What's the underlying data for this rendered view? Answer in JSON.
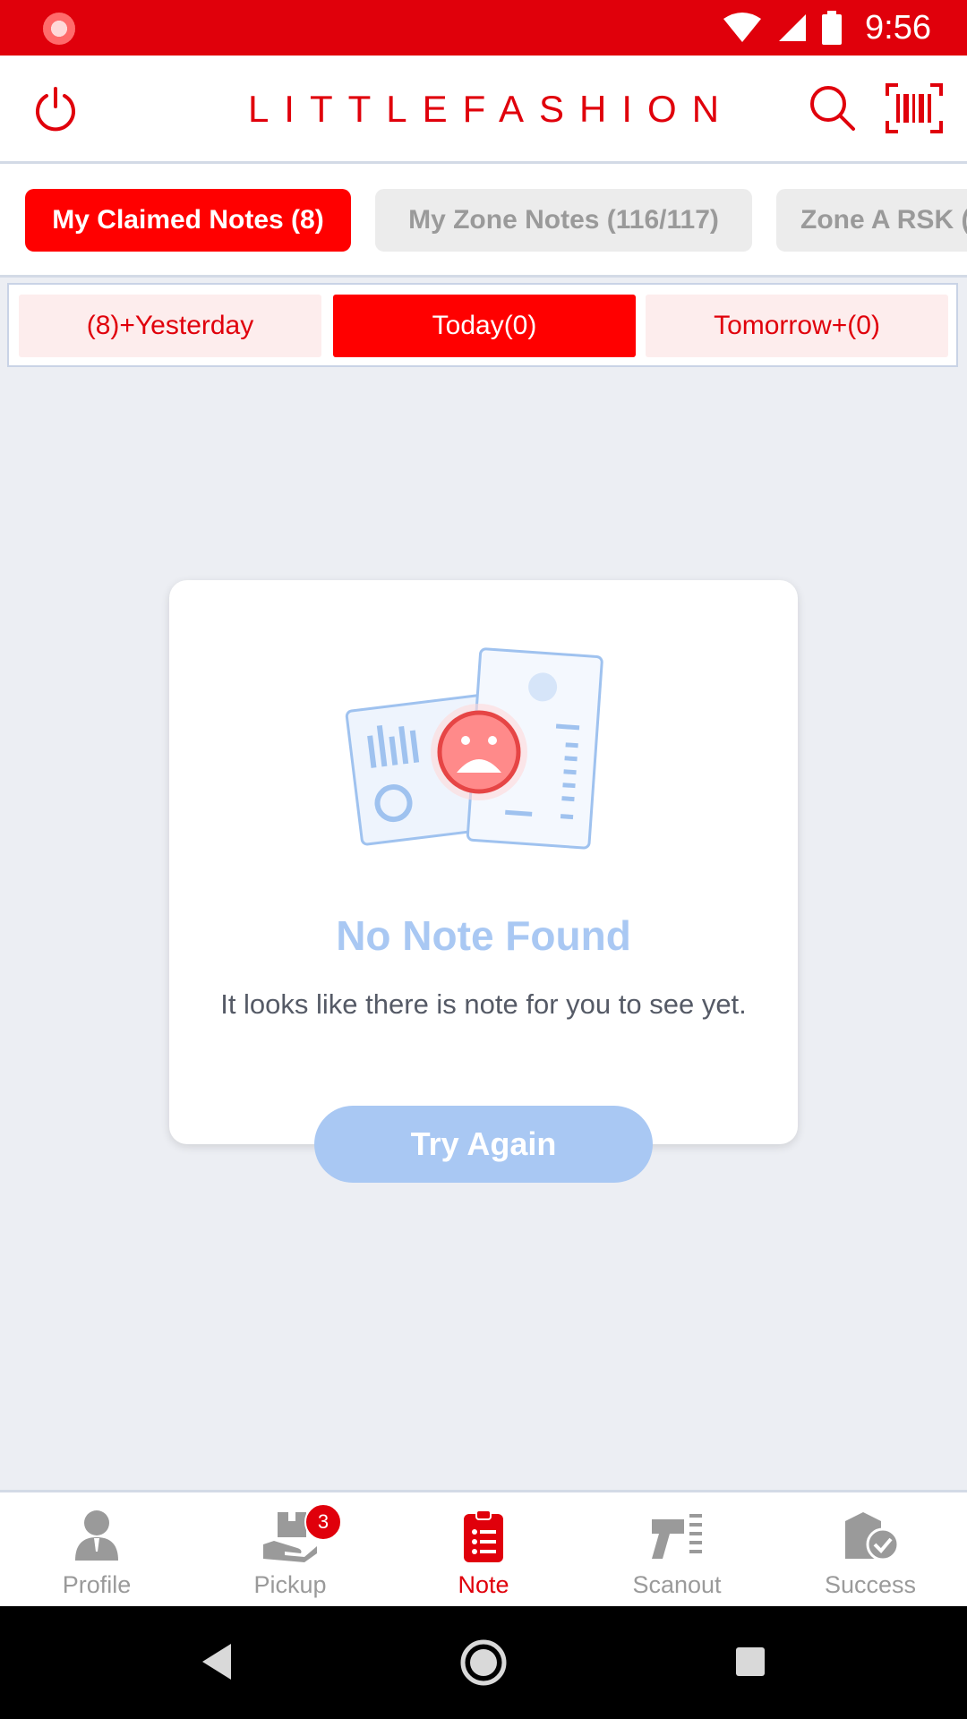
{
  "status_bar": {
    "time": "9:56"
  },
  "header": {
    "brand": "LITTLEFASHION"
  },
  "tabs": [
    {
      "label": "My Claimed Notes (8)",
      "active": true
    },
    {
      "label": "My Zone Notes (116/117)",
      "active": false
    },
    {
      "label": "Zone A RSK (",
      "active": false
    }
  ],
  "subtabs": [
    {
      "label": "(8)+Yesterday",
      "active": false
    },
    {
      "label": "Today(0)",
      "active": true
    },
    {
      "label": "Tomorrow+(0)",
      "active": false
    }
  ],
  "empty_state": {
    "title": "No Note Found",
    "message": "It looks like there is note for you to see yet.",
    "button": "Try Again"
  },
  "bottom_nav": [
    {
      "label": "Profile",
      "icon": "profile-icon",
      "active": false
    },
    {
      "label": "Pickup",
      "icon": "pickup-icon",
      "active": false,
      "badge": "3"
    },
    {
      "label": "Note",
      "icon": "note-icon",
      "active": true
    },
    {
      "label": "Scanout",
      "icon": "scanout-icon",
      "active": false
    },
    {
      "label": "Success",
      "icon": "success-icon",
      "active": false
    }
  ],
  "colors": {
    "accent": "#e0000b",
    "chip_active": "#ff0000",
    "empty_blue": "#a9c8f3"
  }
}
